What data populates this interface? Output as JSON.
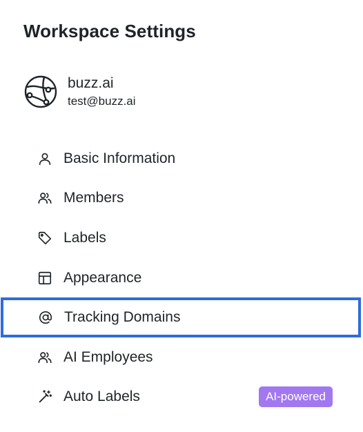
{
  "header": {
    "title": "Workspace Settings"
  },
  "workspace": {
    "name": "buzz.ai",
    "email": "test@buzz.ai",
    "avatar_icon": "buzz-logo-icon"
  },
  "nav": {
    "items": [
      {
        "label": "Basic Information",
        "icon": "user-icon"
      },
      {
        "label": "Members",
        "icon": "users-icon"
      },
      {
        "label": "Labels",
        "icon": "tag-icon"
      },
      {
        "label": "Appearance",
        "icon": "layout-icon"
      },
      {
        "label": "Tracking Domains",
        "icon": "at-sign-icon",
        "selected": true
      },
      {
        "label": "AI Employees",
        "icon": "users-icon"
      },
      {
        "label": "Auto Labels",
        "icon": "magic-wand-icon",
        "badge": "AI-powered"
      }
    ]
  },
  "colors": {
    "selected_border": "#2f6bdb",
    "badge_bg": "#a178f0",
    "text": "#1f2328"
  }
}
